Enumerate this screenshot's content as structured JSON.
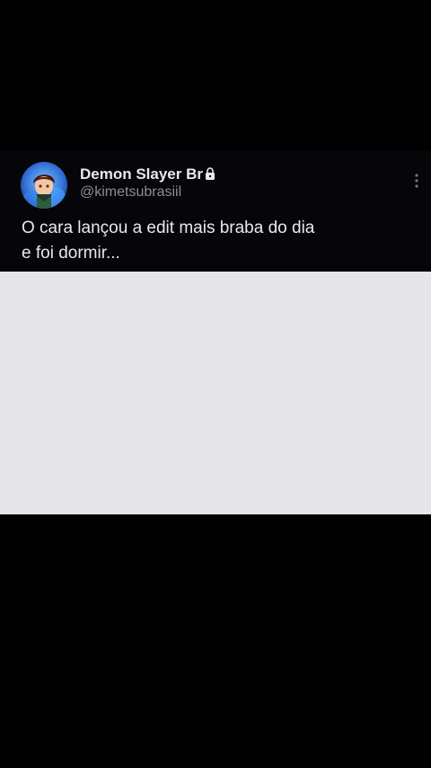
{
  "tweet": {
    "author_name": "Demon Slayer Br",
    "author_handle": "@kimetsubrasiil",
    "protected_icon": "lock-icon",
    "more_icon": "more-vertical-icon",
    "text_lines": [
      "O cara lançou a edit mais braba do dia",
      "e foi dormir..."
    ]
  },
  "colors": {
    "background": "#000000",
    "text_primary": "#e7e9ea",
    "text_secondary": "#8b8f94",
    "media_placeholder": "#e6e6e8"
  }
}
